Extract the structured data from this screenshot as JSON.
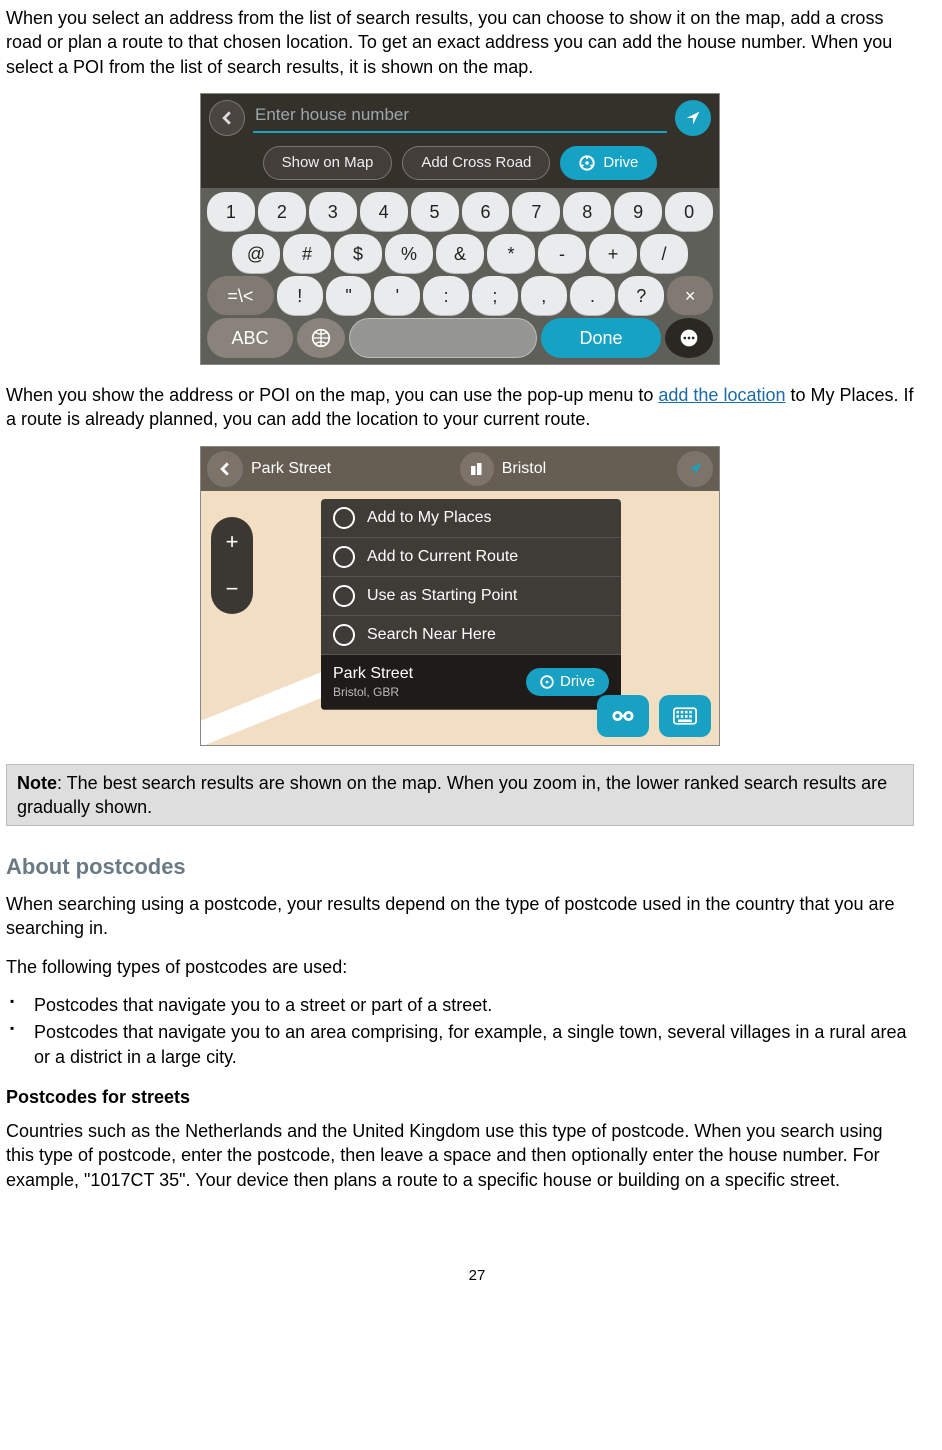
{
  "p1": "When you select an address from the list of search results, you can choose to show it on the map, add a cross road or plan a route to that chosen location. To get an exact address you can add the house number. When you select a POI from the list of search results, it is shown on the map.",
  "shot1": {
    "placeholder": "Enter house number",
    "show_on_map": "Show on Map",
    "add_cross_road": "Add Cross Road",
    "drive": "Drive",
    "row_digits": [
      "1",
      "2",
      "3",
      "4",
      "5",
      "6",
      "7",
      "8",
      "9",
      "0"
    ],
    "row_syms1": [
      "@",
      "#",
      "$",
      "%",
      "&",
      "*",
      "-",
      "+",
      "/"
    ],
    "row_syms2": [
      "=\\<",
      "!",
      "\"",
      "'",
      ":",
      ";",
      ",",
      ".",
      "?",
      "×"
    ],
    "abc": "ABC",
    "done": "Done"
  },
  "p2a": "When you show the address or POI on the map, you can use the pop-up menu to ",
  "p2_link": "add the location",
  "p2b": " to My Places. If a route is already planned, you can add the location to your current route.",
  "shot2": {
    "left_field": "Park Street",
    "right_field": "Bristol",
    "menu": [
      "Add to My Places",
      "Add to Current Route",
      "Use as Starting Point",
      "Search Near Here"
    ],
    "selected_title": "Park Street",
    "selected_sub": "Bristol, GBR",
    "drive": "Drive",
    "zoom_plus": "+",
    "zoom_minus": "−"
  },
  "note_label": "Note",
  "note_body": ": The best search results are shown on the map. When you zoom in, the lower ranked search results are gradually shown.",
  "h2": "About postcodes",
  "p3": "When searching using a postcode, your results depend on the type of postcode used in the country that you are searching in.",
  "p4": "The following types of postcodes are used:",
  "bullets": [
    "Postcodes that navigate you to a street or part of a street.",
    "Postcodes that navigate you to an area comprising, for example, a single town, several villages in a rural area or a district in a large city."
  ],
  "subhead": "Postcodes for streets",
  "p5": "Countries such as the Netherlands and the United Kingdom use this type of postcode. When you search using this type of postcode, enter the postcode, then leave a space and then optionally enter the house number. For example, \"1017CT 35\". Your device then plans a route to a specific house or building on a specific street.",
  "page_number": "27"
}
